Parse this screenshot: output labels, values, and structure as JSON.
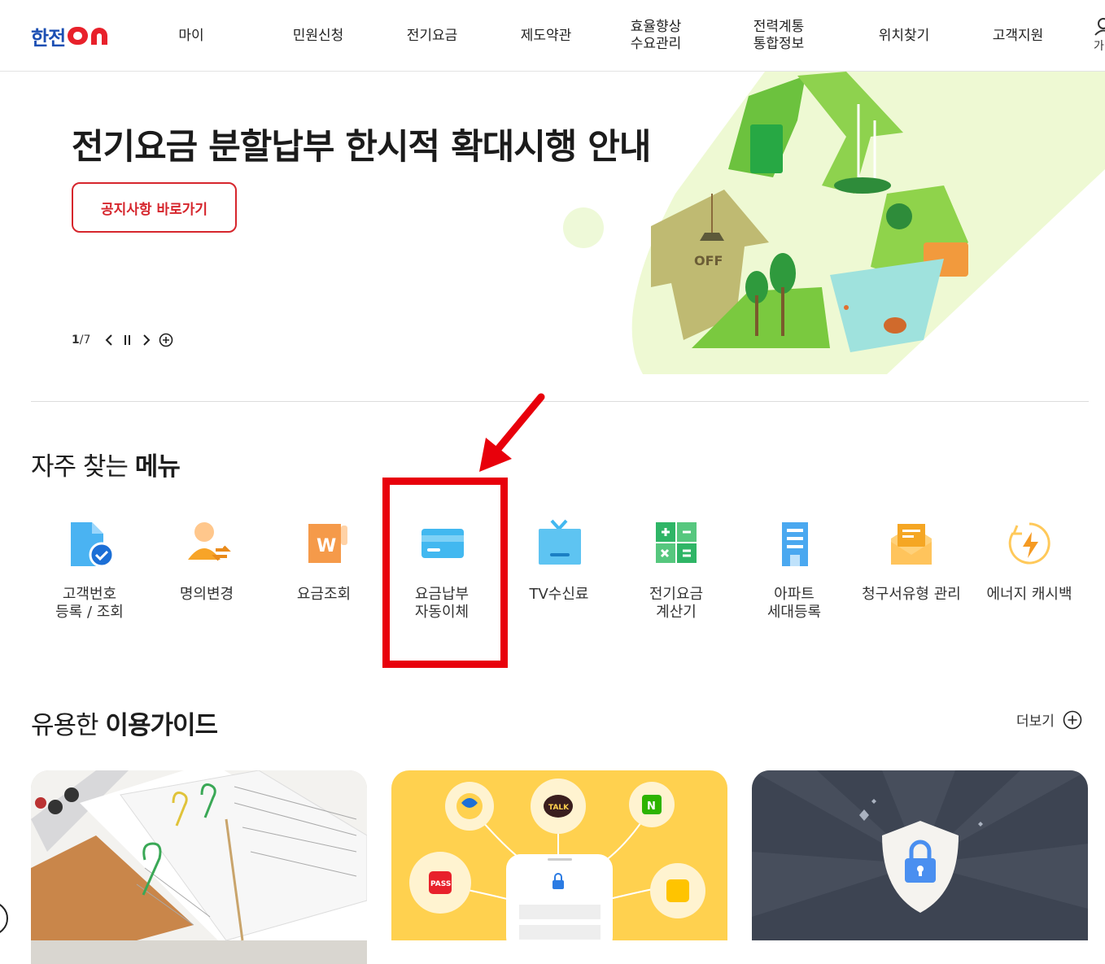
{
  "header": {
    "logo_text": "한전",
    "logo_on": "ON",
    "nav": [
      {
        "label": "마이"
      },
      {
        "label": "민원신청"
      },
      {
        "label": "전기요금"
      },
      {
        "label": "제도약관"
      },
      {
        "label": "효율향상\n수요관리"
      },
      {
        "label": "전력계통\n통합정보"
      },
      {
        "label": "위치찾기"
      },
      {
        "label": "고객지원"
      }
    ],
    "user_label": "가"
  },
  "hero": {
    "title": "전기요금 분할납부 한시적 확대시행 안내",
    "button_label": "공지사항 바로가기",
    "pager_current": "1",
    "pager_total": "7",
    "art_text": "OFF"
  },
  "frequent_menu": {
    "title_normal": "자주 찾는",
    "title_bold": "메뉴",
    "items": [
      {
        "label": "고객번호\n등록 / 조회",
        "icon": "document-check-icon"
      },
      {
        "label": "명의변경",
        "icon": "person-change-icon"
      },
      {
        "label": "요금조회",
        "icon": "won-bill-icon"
      },
      {
        "label": "요금납부\n자동이체",
        "icon": "credit-card-icon"
      },
      {
        "label": "TV수신료",
        "icon": "tv-icon"
      },
      {
        "label": "전기요금\n계산기",
        "icon": "calculator-icon"
      },
      {
        "label": "아파트\n세대등록",
        "icon": "apartment-icon"
      },
      {
        "label": "청구서유형 관리",
        "icon": "envelope-icon"
      },
      {
        "label": "에너지 캐시백",
        "icon": "energy-cashback-icon"
      }
    ]
  },
  "guide": {
    "title_normal": "유용한",
    "title_bold": "이용가이드",
    "more_label": "더보기",
    "cards": [
      {
        "icon": "documents-photo"
      },
      {
        "icon": "auth-apps-illustration",
        "badges": [
          "TALK",
          "N",
          "PASS"
        ]
      },
      {
        "icon": "shield-lock-icon"
      }
    ]
  },
  "colors": {
    "brand_blue": "#1c4fb3",
    "brand_red": "#e8212b",
    "highlight_red": "#e8000b",
    "accent_blue": "#42b8f0"
  }
}
